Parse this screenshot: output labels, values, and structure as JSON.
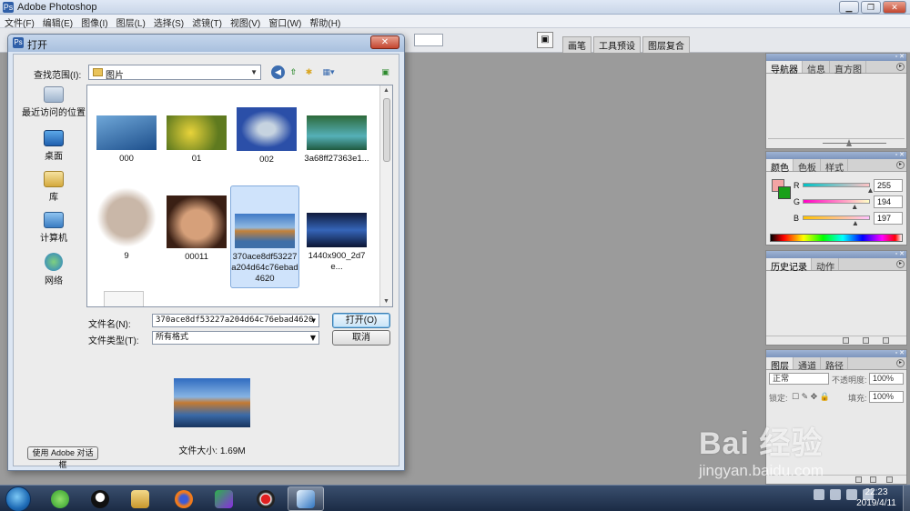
{
  "app": {
    "title": "Adobe Photoshop",
    "menu": [
      "文件(F)",
      "编辑(E)",
      "图像(I)",
      "图层(L)",
      "选择(S)",
      "滤镜(T)",
      "视图(V)",
      "窗口(W)",
      "帮助(H)"
    ],
    "well_tabs": [
      "画笔",
      "工具预设",
      "图层复合"
    ]
  },
  "dialog": {
    "title": "打开",
    "look_in_label": "查找范围(I):",
    "look_in_value": "图片",
    "places": [
      "最近访问的位置",
      "桌面",
      "库",
      "计算机",
      "网络"
    ],
    "files": [
      {
        "name": "000"
      },
      {
        "name": "01"
      },
      {
        "name": "002"
      },
      {
        "name": "3a68ff27363e1..."
      },
      {
        "name": "9"
      },
      {
        "name": "00011"
      },
      {
        "name": "370ace8df53227a204d64c76ebad4620",
        "selected": true
      },
      {
        "name": "1440x900_2d7e..."
      }
    ],
    "filename_label": "文件名(N):",
    "filename_value": "370ace8df53227a204d64c76ebad4620",
    "filetype_label": "文件类型(T):",
    "filetype_value": "所有格式",
    "open_label": "打开(O)",
    "cancel_label": "取消",
    "filesize": "文件大小: 1.69M",
    "adobe_dialog_label": "使用 Adobe 对话框"
  },
  "palettes": {
    "navigator_tabs": [
      "导航器",
      "信息",
      "直方图"
    ],
    "color_tabs": [
      "颜色",
      "色板",
      "样式"
    ],
    "color": {
      "r_label": "R",
      "g_label": "G",
      "b_label": "B",
      "r": "255",
      "g": "194",
      "b": "197",
      "r_level": 1.0,
      "g_level": 0.76,
      "b_level": 0.77
    },
    "history_tabs": [
      "历史记录",
      "动作"
    ],
    "layers_tabs": [
      "图层",
      "通道",
      "路径"
    ],
    "blend_mode": "正常",
    "opacity_label": "不透明度:",
    "opacity_value": "100%",
    "lock_label": "锁定:",
    "fill_label": "填充:",
    "fill_value": "100%"
  },
  "taskbar": {
    "time": "22:23",
    "date": "2019/4/11"
  },
  "watermark": {
    "logo": "Bai 经验",
    "url": "jingyan.baidu.com"
  },
  "colors": {
    "swatch_bg": "#f3a4a4",
    "swatch_fg": "#18a018",
    "dialog_frame": "#dce6f3",
    "selection": "#cfe3fb"
  }
}
